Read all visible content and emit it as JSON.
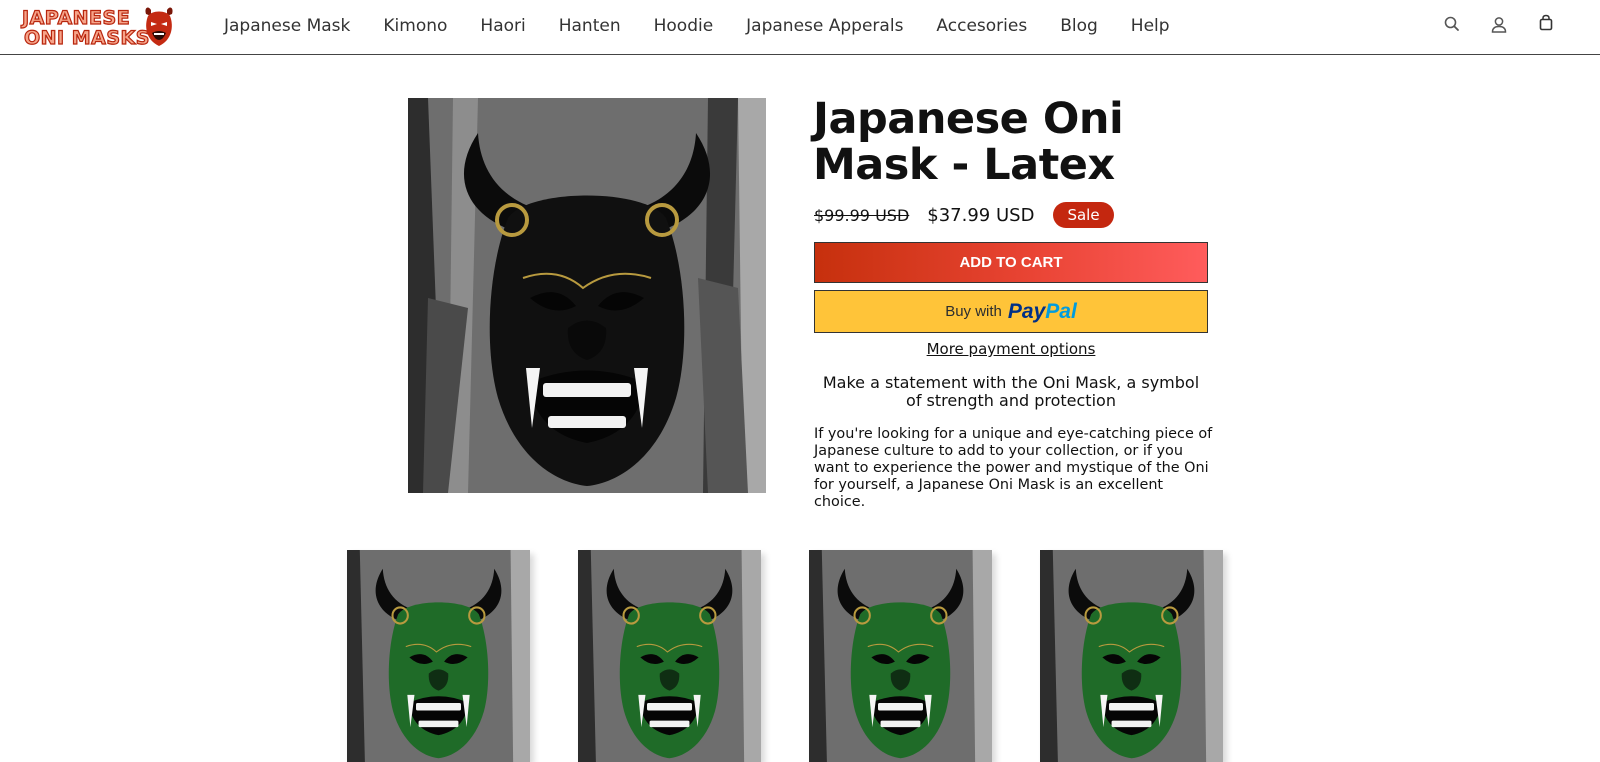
{
  "header": {
    "logo": {
      "line1": "JAPANESE",
      "line2": "ONI MASKS"
    },
    "nav": [
      {
        "label": "Japanese Mask"
      },
      {
        "label": "Kimono"
      },
      {
        "label": "Haori"
      },
      {
        "label": "Hanten"
      },
      {
        "label": "Hoodie"
      },
      {
        "label": "Japanese Apperals"
      },
      {
        "label": "Accesories"
      },
      {
        "label": "Blog"
      },
      {
        "label": "Help"
      }
    ],
    "icons": [
      "search-icon",
      "account-icon",
      "cart-icon"
    ]
  },
  "product": {
    "title": "Japanese Oni Mask - Latex",
    "compare_price": "$99.99 USD",
    "price": "$37.99 USD",
    "badge": "Sale",
    "add_to_cart": "ADD TO CART",
    "paypal": {
      "buy_with": "Buy with",
      "pay": "Pay",
      "pal": "Pal"
    },
    "more_payment": "More payment options",
    "tagline": "Make a statement with the Oni Mask, a symbol of  strength and protection",
    "description": "If you're looking for a unique and eye-catching piece of Japanese culture to add to your collection, or if you want to experience the power and mystique of the Oni for yourself, a Japanese Oni Mask is an excellent choice."
  },
  "colors": {
    "sale_badge": "#c4270f",
    "add_to_cart_start": "#c6300d",
    "add_to_cart_end": "#ff5c5c",
    "paypal_yellow": "#ffc439",
    "main_mask": "#101010",
    "thumb_mask": "#1f6b28"
  },
  "thumbnails": [
    {
      "variant": "green"
    },
    {
      "variant": "green"
    },
    {
      "variant": "green"
    },
    {
      "variant": "green"
    }
  ]
}
